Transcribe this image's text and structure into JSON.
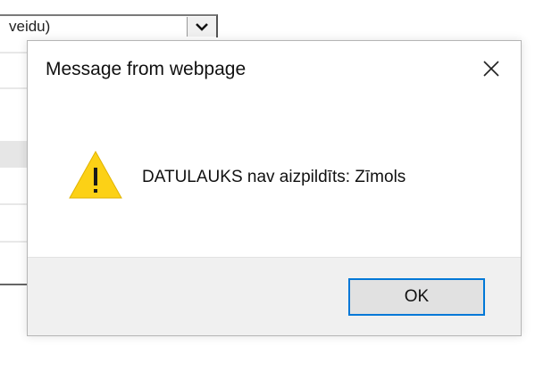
{
  "background": {
    "select_text": "veidu)",
    "select_arrow_icon": "chevron-down-icon"
  },
  "dialog": {
    "title": "Message from webpage",
    "close_icon": "close-icon",
    "warning_icon": "warning-icon",
    "message": "DATULAUKS nav aizpildīts: Zīmols",
    "ok_label": "OK"
  },
  "colors": {
    "accent_border": "#0078d7",
    "warning_yellow": "#fcd116",
    "footer_bg": "#f0f0f0"
  }
}
